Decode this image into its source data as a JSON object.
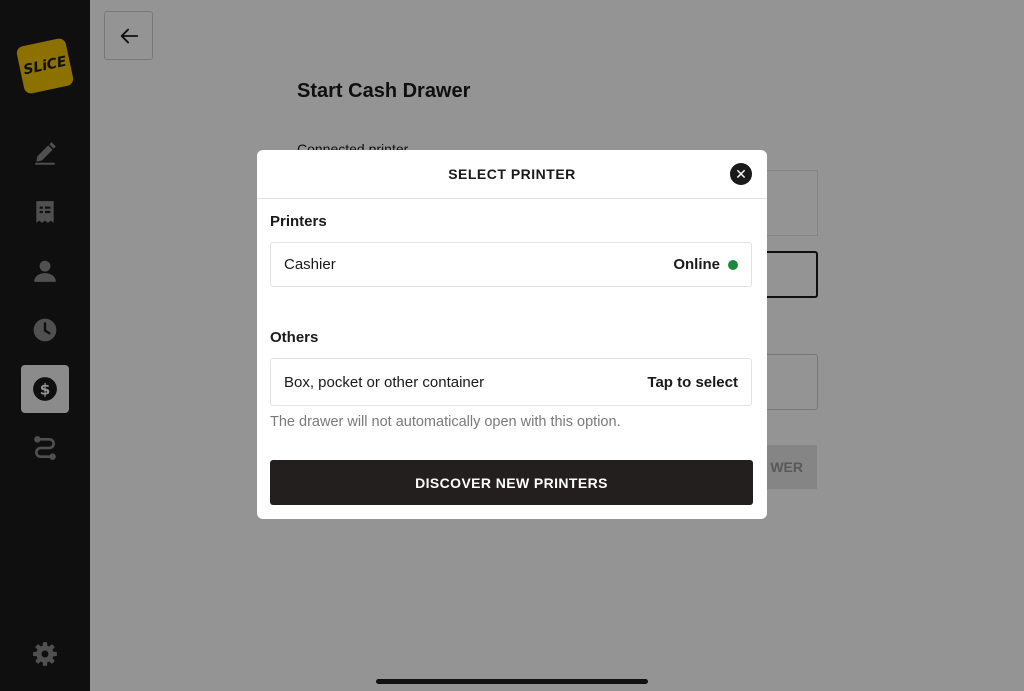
{
  "app": {
    "logo_text": "SLiCE",
    "brand_color": "#f2c200"
  },
  "sidebar": {
    "items": [
      {
        "icon": "pencil-icon",
        "active": false
      },
      {
        "icon": "receipt-icon",
        "active": false
      },
      {
        "icon": "person-icon",
        "active": false
      },
      {
        "icon": "clock-icon",
        "active": false
      },
      {
        "icon": "dollar-icon",
        "active": true
      },
      {
        "icon": "route-icon",
        "active": false
      },
      {
        "icon": "gear-icon",
        "active": false
      }
    ]
  },
  "page": {
    "title": "Start Cash Drawer",
    "connected_printer_label": "Connected printer",
    "background_button_fragment": "WER"
  },
  "modal": {
    "title": "SELECT PRINTER",
    "printers_label": "Printers",
    "printers": [
      {
        "name": "Cashier",
        "status": "Online",
        "status_color": "#1a8a3a"
      }
    ],
    "others_label": "Others",
    "others": [
      {
        "name": "Box, pocket or other container",
        "action": "Tap to select"
      }
    ],
    "helper_text": "The drawer will not automatically open with this option.",
    "discover_button": "DISCOVER NEW PRINTERS"
  }
}
